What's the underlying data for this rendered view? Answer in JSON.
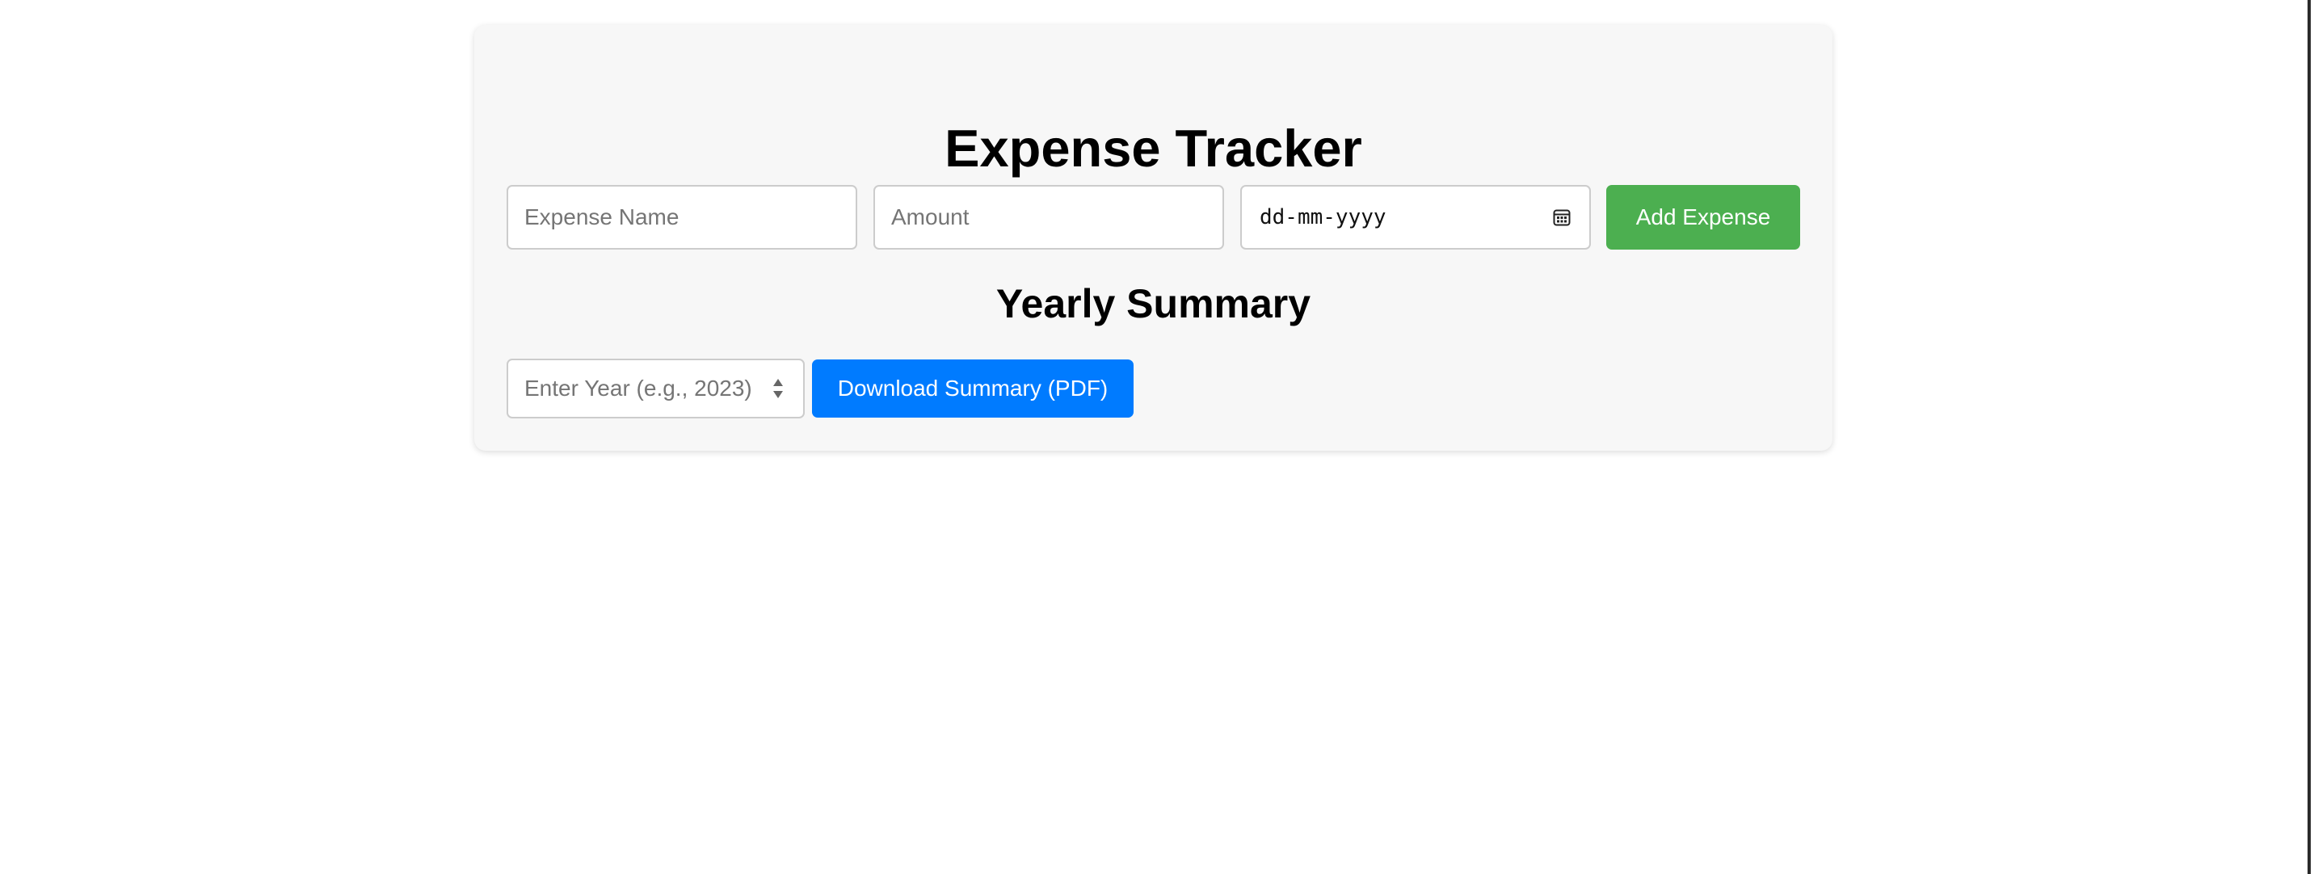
{
  "app": {
    "title": "Expense Tracker"
  },
  "expense_form": {
    "name_placeholder": "Expense Name",
    "amount_placeholder": "Amount",
    "date_placeholder": "dd-mm-yyyy",
    "add_button_label": "Add Expense",
    "calendar_icon": "calendar-icon"
  },
  "summary": {
    "heading": "Yearly Summary",
    "year_placeholder": "Enter Year (e.g., 2023)",
    "spinner_icon": "number-spinner-icon",
    "download_button_label": "Download Summary (PDF)"
  },
  "colors": {
    "card_background": "#f7f7f7",
    "add_button": "#4caf50",
    "download_button": "#007bff"
  }
}
